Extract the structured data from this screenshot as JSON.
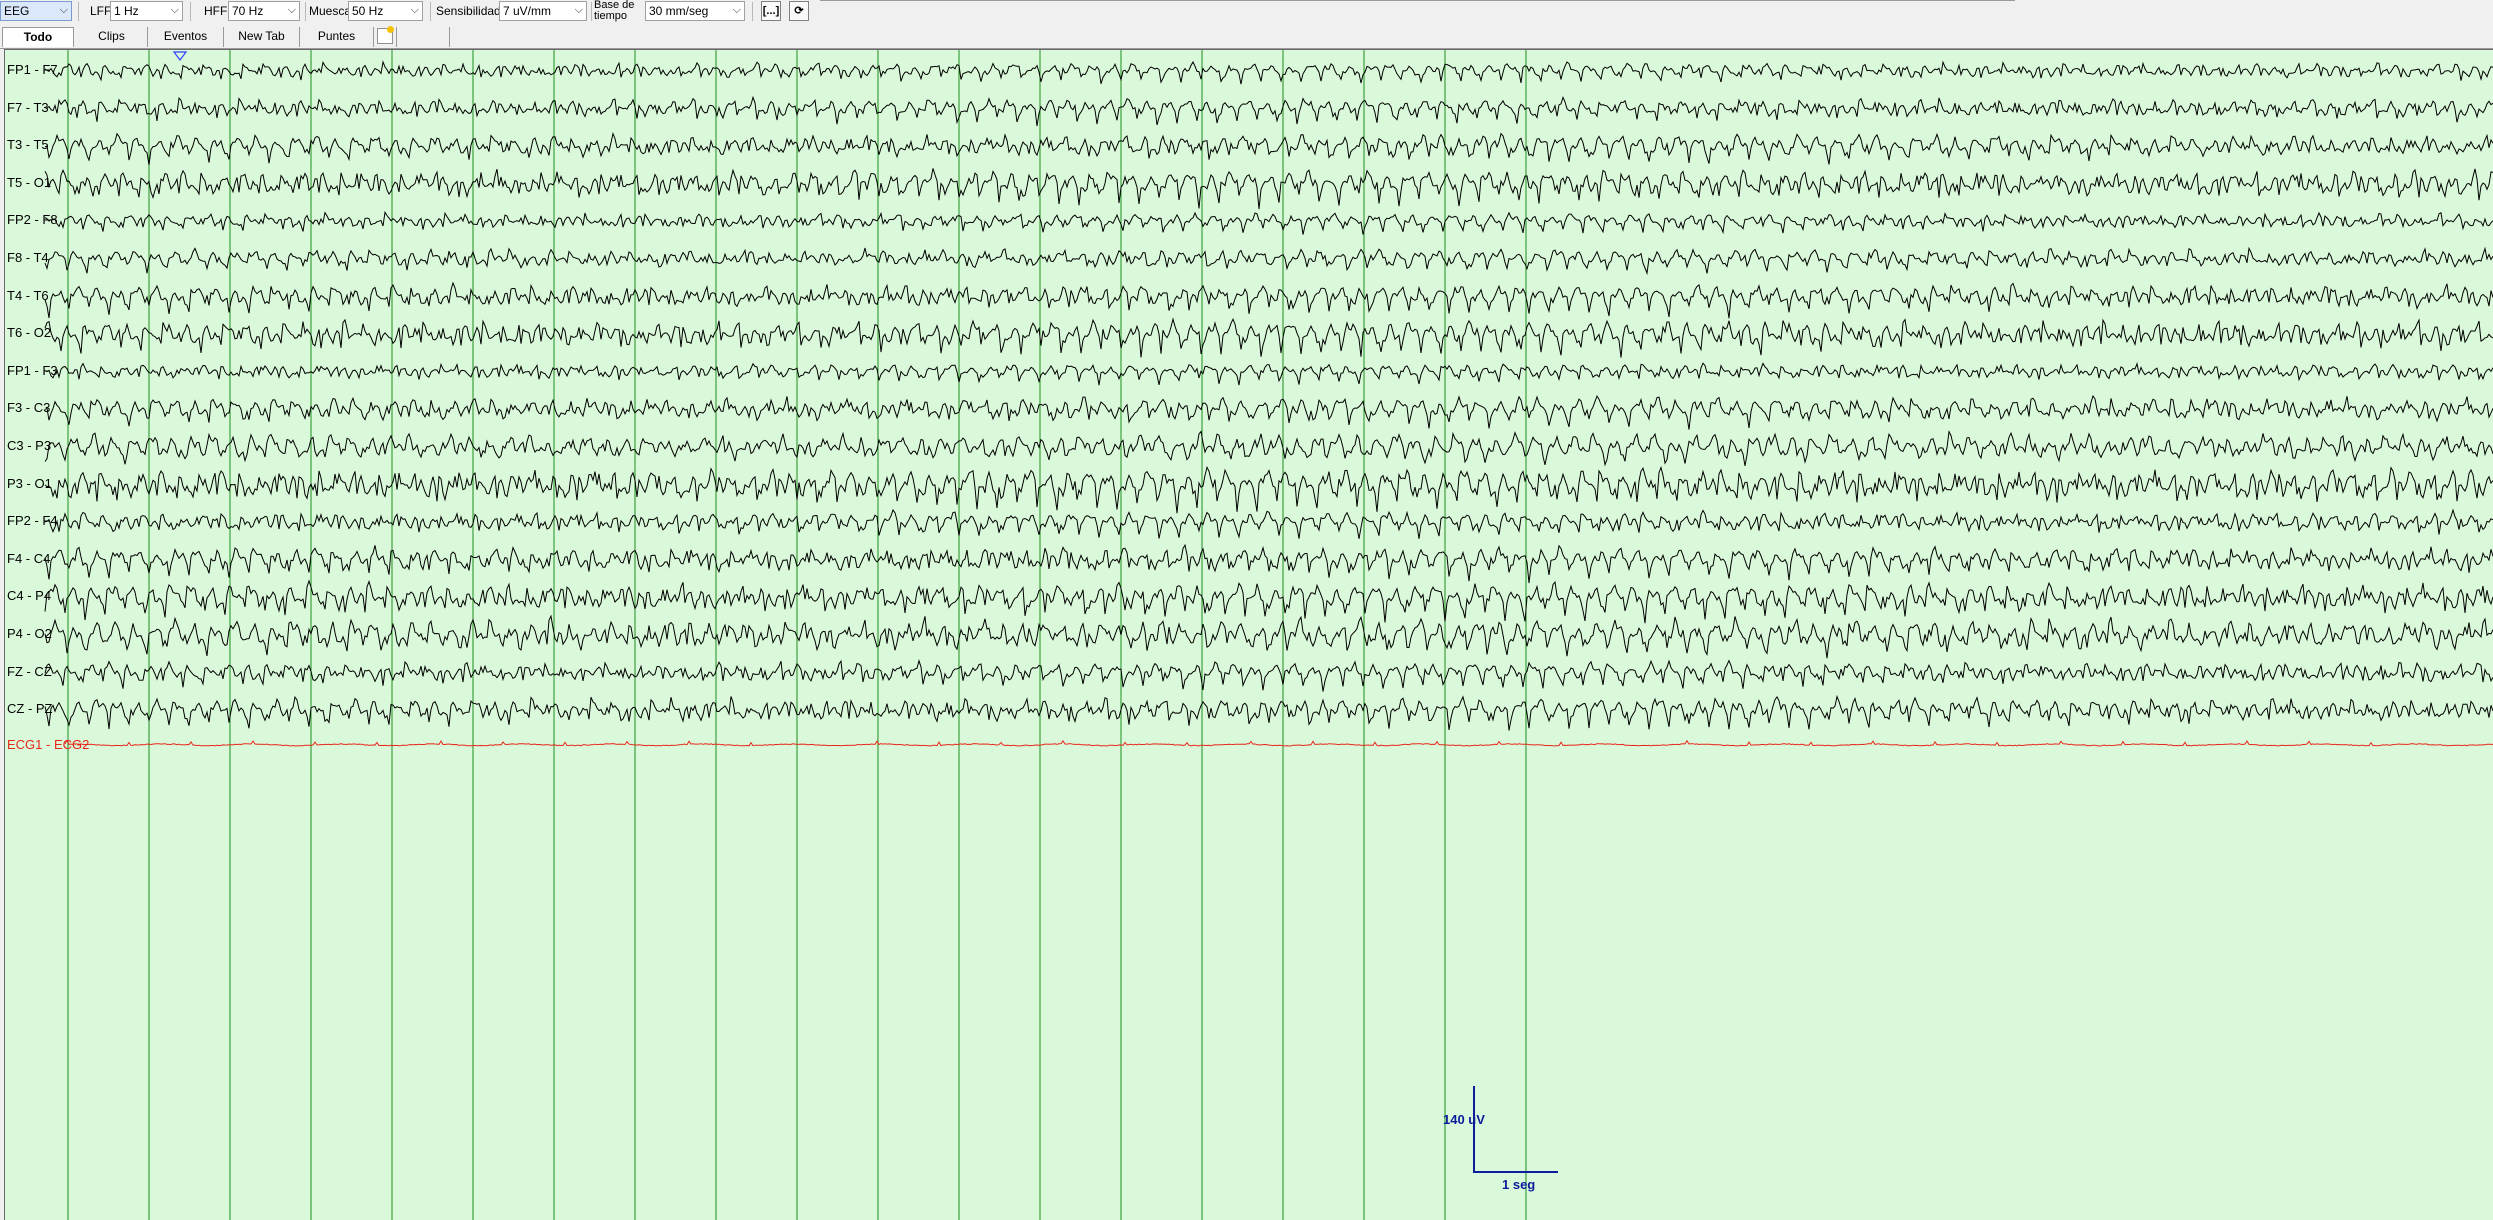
{
  "toolbar": {
    "mode": "EEG",
    "lff_label": "LFF",
    "lff_value": "1 Hz",
    "hff_label": "HFF",
    "hff_value": "70 Hz",
    "notch_label": "Muesca",
    "notch_value": "50 Hz",
    "sensitivity_label": "Sensibilidad",
    "sensitivity_value": "7 uV/mm",
    "timebase_label_line1": "Base de",
    "timebase_label_line2": "tiempo",
    "timebase_value": "30 mm/seg",
    "bracket_button": "[...]",
    "refresh_icon": "refresh-icon"
  },
  "tabs": [
    {
      "label": "Todo",
      "active": true
    },
    {
      "label": "Clips",
      "active": false
    },
    {
      "label": "Eventos",
      "active": false
    },
    {
      "label": "New Tab",
      "active": false
    },
    {
      "label": "Puntes",
      "active": false
    }
  ],
  "new_tab_icon": "new-tab-icon",
  "eeg": {
    "background_color": "#daf9da",
    "gridline_color": "#1f8f1f",
    "trace_color": "#000000",
    "ecg_color": "#e8261a",
    "event_marker_color": "#3040ff",
    "seconds_shown": 19,
    "channels": [
      "FP1 - F7",
      "F7 - T3",
      "T3 - T5",
      "T5 - O1",
      "FP2 - F8",
      "F8 - T4",
      "T4 - T6",
      "T6 - O2",
      "FP1 - F3",
      "F3 - C3",
      "C3 - P3",
      "P3 - O1",
      "FP2 - F4",
      "F4 - C4",
      "C4 - P4",
      "P4 - O2",
      "FZ - CZ",
      "CZ - PZ"
    ],
    "ecg_channel": "ECG1 - ECG2",
    "calibration": {
      "amplitude_label": "140 uV",
      "time_label": "1 seg",
      "color": "#0c1c9a"
    }
  }
}
